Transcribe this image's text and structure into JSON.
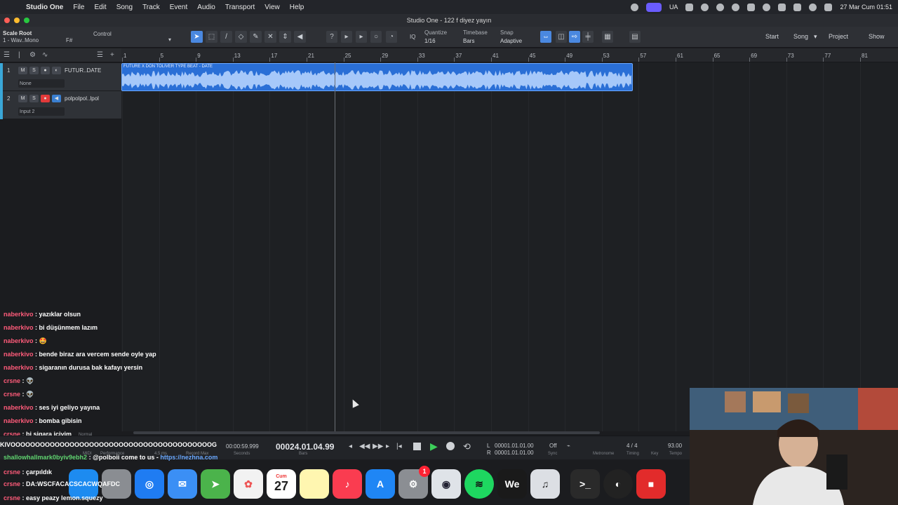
{
  "menubar": {
    "app": "Studio One",
    "items": [
      "File",
      "Edit",
      "Song",
      "Track",
      "Event",
      "Audio",
      "Transport",
      "View",
      "Help"
    ],
    "status_lang": "UA",
    "clock": "27 Mar Cum  01:51"
  },
  "window": {
    "title": "Studio One - 122 f diyez yayın"
  },
  "toolbar": {
    "scale_root_label": "Scale Root",
    "scale_root_value": "F#",
    "scale_sub": "1 - Wav..Mono",
    "control_label": "Control",
    "quantize_label": "Quantize",
    "quantize_value": "1/16",
    "timebase_label": "Timebase",
    "timebase_value": "Bars",
    "snap_label": "Snap",
    "snap_value": "Adaptive",
    "iq_label": "IQ",
    "start_label": "Start",
    "song_label": "Song",
    "project_label": "Project",
    "show_label": "Show"
  },
  "tracks": [
    {
      "num": "1",
      "name": "FUTUR..DATE",
      "sub": "None",
      "color": "#3aa7d8"
    },
    {
      "num": "2",
      "name": "polpolpol..lpol",
      "sub": "Input 2",
      "color": "#3aa7d8"
    }
  ],
  "ruler": {
    "ticks": [
      "1",
      "5",
      "9",
      "13",
      "17",
      "21",
      "25",
      "29",
      "33",
      "37",
      "41",
      "45",
      "49",
      "53",
      "57",
      "61",
      "65",
      "69",
      "73",
      "77",
      "81"
    ]
  },
  "clip": {
    "name": "FUTURE X DON TOLIVER TYPE BEAT - DATE"
  },
  "chat": [
    {
      "user": "naberkivo",
      "msg": "yazıklar olsun"
    },
    {
      "user": "naberkivo",
      "msg": "bi düşünmem lazım"
    },
    {
      "user": "naberkivo",
      "msg": "🤩"
    },
    {
      "user": "naberkivo",
      "msg": "bende biraz ara vercem sende oyle yap"
    },
    {
      "user": "naberkivo",
      "msg": "sigaranın durusa bak kafayı yersin"
    },
    {
      "user": "crsne",
      "msg": "👽"
    },
    {
      "user": "crsne",
      "msg": "👽"
    },
    {
      "user": "naberkivo",
      "msg": "ses iyi geliyo yayına"
    },
    {
      "user": "naberkivo",
      "msg": "bomba gibisin"
    },
    {
      "user": "crsne",
      "msg": "bi sigara içiyim"
    }
  ],
  "chat_overlay": {
    "line1": "KIVOOOOOOOOOOOOOOOOOOOOOOOOOOOOOOOOOOOOOOOOOG",
    "line2_user": "shallowhallmark0byiv9ebh2",
    "line2_msg": ": @polboii come to us -",
    "line2_link": "https://nezhna.com"
  },
  "chat_bottom": [
    {
      "user": "crsne",
      "msg": "çarpıldık"
    },
    {
      "user": "crsne",
      "msg": "DA:WSCFACACSCACWQAFDC"
    },
    {
      "user": "crsne",
      "msg": "easy peazy lemon.squezy"
    }
  ],
  "transport": {
    "seconds": "00:00:59.999",
    "seconds_label": "Seconds",
    "bars": "00024.01.04.99",
    "bars_label": "Bars",
    "loop_l": "00001.01.01.00",
    "loop_r": "00001.01.01.00",
    "sync": "Off",
    "sync_label": "Sync",
    "metronome_label": "Metronome",
    "timing": "4 / 4",
    "timing_label": "Timing",
    "key_label": "Key",
    "tempo": "93.00",
    "tempo_label": "Tempo",
    "perf_label": "Performance",
    "rec_label": "Record Max",
    "rec_value": "4.5 ms",
    "midi_label": "MIDI",
    "normal": "Normal"
  },
  "dock": {
    "calendar_day": "27",
    "calendar_month": "Cum",
    "badge": "1"
  },
  "colors": {
    "accent": "#4a88e0",
    "clip": "#2a6fd6",
    "username": "#ff5b7a",
    "link": "#6aa8ff"
  }
}
